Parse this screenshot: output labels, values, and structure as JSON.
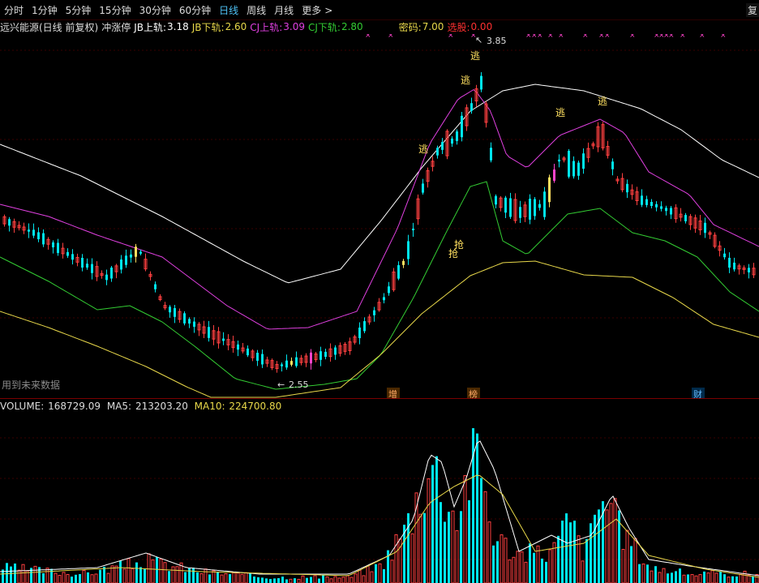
{
  "toolbar": {
    "tabs": [
      {
        "label": "分时",
        "active": false
      },
      {
        "label": "1分钟",
        "active": false
      },
      {
        "label": "5分钟",
        "active": false
      },
      {
        "label": "15分钟",
        "active": false
      },
      {
        "label": "30分钟",
        "active": false
      },
      {
        "label": "60分钟",
        "active": false
      },
      {
        "label": "日线",
        "active": true
      },
      {
        "label": "周线",
        "active": false
      },
      {
        "label": "月线",
        "active": false
      }
    ],
    "more_label": "更多",
    "more_arrow": ">",
    "right_label": "复"
  },
  "info": {
    "title": "远兴能源(日线 前复权)",
    "indicator": "冲涨停",
    "jb_upper_label": "JB上轨:",
    "jb_upper_value": "3.18",
    "jb_lower_label": "JB下轨:",
    "jb_lower_value": "2.60",
    "cj_upper_label": "CJ上轨:",
    "cj_upper_value": "3.09",
    "cj_lower_label": "CJ下轨:",
    "cj_lower_value": "2.80",
    "code_label": "密码:",
    "code_value": "7.00",
    "pick_label": "选股:",
    "pick_value": "0.00"
  },
  "chart_labels": {
    "high_marker": "3.85",
    "low_marker": "2.55",
    "escape": "逃",
    "grab": "抢",
    "events": [
      "增",
      "榜",
      "财"
    ],
    "future_note": "用到未来数据"
  },
  "volume": {
    "label": "VOLUME:",
    "value": "168729.09",
    "ma5_label": "MA5:",
    "ma5_value": "213203.20",
    "ma10_label": "MA10:",
    "ma10_value": "224700.80"
  },
  "colors": {
    "up": "#ff4040",
    "down": "#00e5ee",
    "white": "#ffffff",
    "magenta": "#e040e0",
    "green": "#33cc33",
    "yellow": "#e8d84a",
    "label_yellow": "#ffe060",
    "pink": "#ff44cc",
    "active_tab": "#4fc3f7",
    "ma5": "#ffffff",
    "ma10": "#e8d84a"
  },
  "chart_data": {
    "type": "candlestick",
    "series_names": [
      "JB上轨",
      "JB下轨",
      "CJ上轨",
      "CJ下轨",
      "VOLUME",
      "MA5",
      "MA10"
    ],
    "price_high": 3.85,
    "price_low": 2.55,
    "last_volume": 168729.09,
    "last_ma5": 213203.2,
    "last_ma10": 224700.8
  }
}
